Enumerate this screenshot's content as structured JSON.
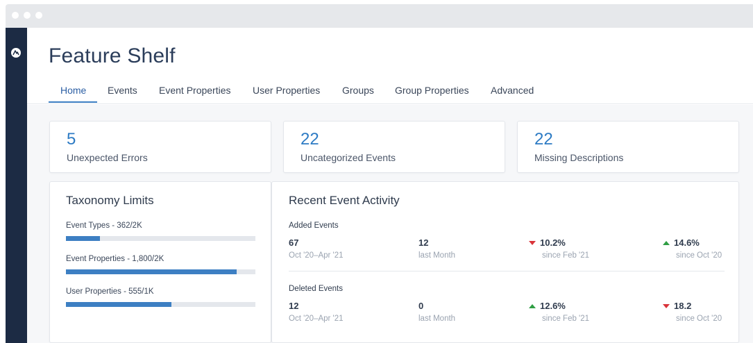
{
  "colors": {
    "accent": "#2d7bc4",
    "sidebar": "#1c2b44",
    "down": "#d9343a",
    "up": "#2f9e44"
  },
  "page_title": "Feature Shelf",
  "tabs": [
    {
      "label": "Home",
      "active": true
    },
    {
      "label": "Events"
    },
    {
      "label": "Event Properties"
    },
    {
      "label": "User Properties"
    },
    {
      "label": "Groups"
    },
    {
      "label": "Group Properties"
    },
    {
      "label": "Advanced"
    }
  ],
  "stats": [
    {
      "value": "5",
      "label": "Unexpected Errors"
    },
    {
      "value": "22",
      "label": "Uncategorized Events"
    },
    {
      "value": "22",
      "label": "Missing Descriptions"
    }
  ],
  "taxonomy": {
    "title": "Taxonomy Limits",
    "limits": [
      {
        "label": "Event Types - 362/2K",
        "fraction": 0.181
      },
      {
        "label": "Event Properties - 1,800/2K",
        "fraction": 0.9
      },
      {
        "label": "User Properties - 555/1K",
        "fraction": 0.555
      }
    ]
  },
  "recent": {
    "title": "Recent Event Activity",
    "groups": [
      {
        "title": "Added Events",
        "metrics": [
          {
            "value": "67",
            "caption": "Oct '20–Apr '21",
            "trend": ""
          },
          {
            "value": "12",
            "caption": "last Month",
            "trend": ""
          },
          {
            "value": "10.2%",
            "caption": "since Feb '21",
            "trend": "down"
          },
          {
            "value": "14.6%",
            "caption": "since Oct '20",
            "trend": "up"
          }
        ]
      },
      {
        "title": "Deleted Events",
        "metrics": [
          {
            "value": "12",
            "caption": "Oct '20–Apr '21",
            "trend": ""
          },
          {
            "value": "0",
            "caption": "last Month",
            "trend": ""
          },
          {
            "value": "12.6%",
            "caption": "since Feb '21",
            "trend": "up"
          },
          {
            "value": "18.2",
            "caption": "since Oct '20",
            "trend": "down"
          }
        ]
      }
    ]
  }
}
